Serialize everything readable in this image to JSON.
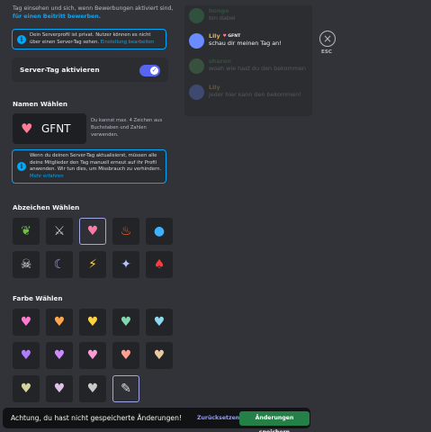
{
  "intro": {
    "text": "Tag einsehen und sich, wenn Bewerbungen aktiviert sind,",
    "link": "für einen Beitritt bewerben."
  },
  "private_notice": {
    "text": "Dein Serverprofil ist privat. Nutzer können es nicht über einen Server-Tag sehen.",
    "link": "Einstellung bearbeiten"
  },
  "server_tag_toggle": {
    "label": "Server-Tag aktivieren",
    "enabled": true
  },
  "name_section": {
    "heading": "Namen Wählen",
    "tag_value": "GFNT",
    "help": "Du kannst max. 4 Zeichen aus Buchstaben und Zahlen verwenden."
  },
  "update_notice": {
    "text": "Wenn du deinen Server-Tag aktualisierst, müssen alle deine Mitglieder den Tag manuell erneut auf ihr Profil anwenden. Wir tun dies, um Missbrauch zu verhindern.",
    "link": "Mehr erfahren"
  },
  "badge_section": {
    "heading": "Abzeichen Wählen",
    "badges": [
      {
        "icon": "leaf-icon",
        "glyph": "❦",
        "color": "#6fbf3f",
        "selected": false
      },
      {
        "icon": "sword-icon",
        "glyph": "⚔",
        "color": "#c9c9c9",
        "selected": false
      },
      {
        "icon": "heart-icon",
        "glyph": "♥",
        "color": "#ff7ba6",
        "selected": true
      },
      {
        "icon": "flame-icon",
        "glyph": "♨",
        "color": "#ff6a2b",
        "selected": false
      },
      {
        "icon": "water-drop-icon",
        "glyph": "●",
        "color": "#3fb2ff",
        "selected": false
      },
      {
        "icon": "skull-icon",
        "glyph": "☠",
        "color": "#e6e6e6",
        "selected": false
      },
      {
        "icon": "moon-icon",
        "glyph": "☾",
        "color": "#b58cff",
        "selected": false
      },
      {
        "icon": "lightning-icon",
        "glyph": "⚡",
        "color": "#ffd23f",
        "selected": false
      },
      {
        "icon": "sparkle-icon",
        "glyph": "✦",
        "color": "#b5c2ff",
        "selected": false
      },
      {
        "icon": "mushroom-icon",
        "glyph": "♠",
        "color": "#ff3b3b",
        "selected": false
      }
    ]
  },
  "color_section": {
    "heading": "Farbe Wählen",
    "colors": [
      {
        "icon": "heart-color-pink-icon",
        "color": "#ff7bd0",
        "selected": false
      },
      {
        "icon": "heart-color-orange-icon",
        "color": "#ffa64d",
        "selected": false
      },
      {
        "icon": "heart-color-yellow-icon",
        "color": "#ffd23f",
        "selected": false
      },
      {
        "icon": "heart-color-mint-icon",
        "color": "#7fd9b0",
        "selected": false
      },
      {
        "icon": "heart-color-cyan-icon",
        "color": "#8fd8f0",
        "selected": false
      },
      {
        "icon": "heart-color-purple-icon",
        "color": "#b07bff",
        "selected": false
      },
      {
        "icon": "heart-color-violet-icon",
        "color": "#d08aff",
        "selected": false
      },
      {
        "icon": "heart-color-rose-icon",
        "color": "#ff9ad6",
        "selected": false
      },
      {
        "icon": "heart-color-salmon-icon",
        "color": "#ffa08f",
        "selected": false
      },
      {
        "icon": "heart-color-beige-icon",
        "color": "#e8c9a0",
        "selected": false
      },
      {
        "icon": "heart-color-khaki-icon",
        "color": "#d6d2a0",
        "selected": false
      },
      {
        "icon": "heart-color-lilac-icon",
        "color": "#e0c0e8",
        "selected": false
      },
      {
        "icon": "heart-color-grey-icon",
        "color": "#c9c9c9",
        "selected": false
      },
      {
        "icon": "custom-color-picker-icon",
        "color": "#dbdee1",
        "selected": true
      }
    ]
  },
  "preview": {
    "messages": [
      {
        "name": "hongo",
        "text": "bin dabei",
        "name_color": "#3ba55c",
        "avatar_color": "#3ba55c",
        "dim": true,
        "badge": false
      },
      {
        "name": "Lily",
        "text": "schau dir meinen Tag an!",
        "name_color": "#f0b232",
        "avatar_color": "#6b8cff",
        "dim": false,
        "badge": true,
        "badge_text": "GFNT"
      },
      {
        "name": "sharon",
        "text": "woah wie hast du den bekommen",
        "name_color": "#3ba55c",
        "avatar_color": "#57a35c",
        "dim": true,
        "badge": false
      },
      {
        "name": "Lily",
        "text": "jeder hier kann den bekommen!",
        "name_color": "#f0b232",
        "avatar_color": "#6b8cff",
        "dim": true,
        "badge": false
      }
    ]
  },
  "close": {
    "label": "ESC"
  },
  "unsaved_bar": {
    "warning": "Achtung, du hast nicht gespeicherte Änderungen!",
    "reset_label": "Zurücksetzen",
    "save_label": "Änderungen speichern"
  }
}
